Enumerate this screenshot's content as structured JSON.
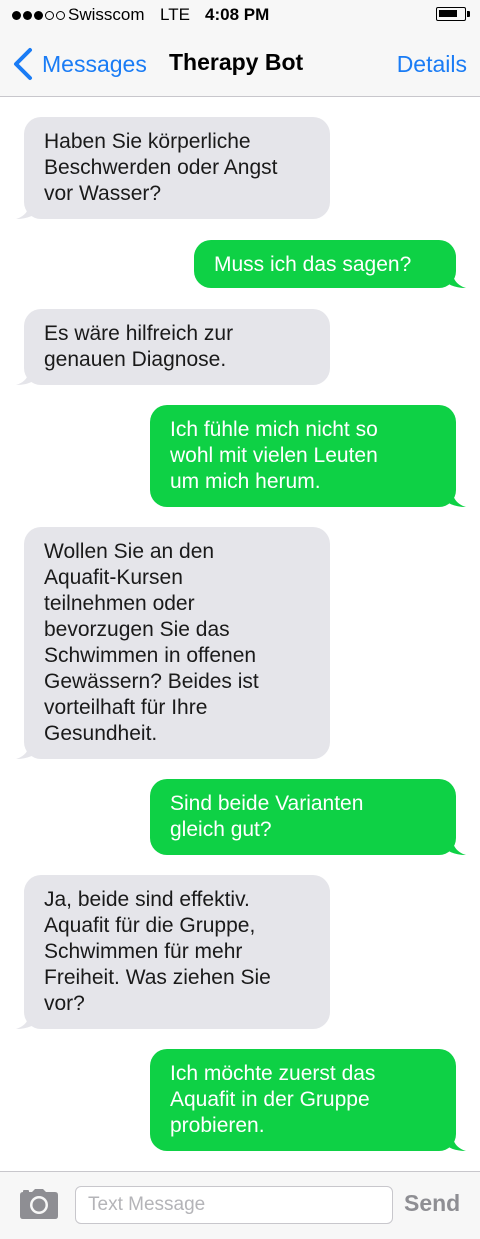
{
  "status_bar": {
    "carrier": "Swisscom",
    "network": "LTE",
    "time": "4:08 PM"
  },
  "nav": {
    "back_label": "Messages",
    "title": "Therapy Bot",
    "details_label": "Details"
  },
  "messages": [
    {
      "from": "bot",
      "text": "Haben Sie körperliche\nBeschwerden oder Angst\nvor Wasser?"
    },
    {
      "from": "user",
      "text": "Muss ich das sagen?"
    },
    {
      "from": "bot",
      "text": "Es wäre hilfreich zur\ngenauen Diagnose."
    },
    {
      "from": "user",
      "text": "Ich fühle mich nicht so\nwohl mit vielen Leuten\num mich herum."
    },
    {
      "from": "bot",
      "text": "Wollen Sie an den\nAquafit-Kursen\nteilnehmen oder\nbevorzugen Sie das\nSchwimmen in offenen\nGewässern? Beides ist\nvorteilhaft für Ihre\nGesundheit."
    },
    {
      "from": "user",
      "text": "Sind beide Varianten\ngleich gut?"
    },
    {
      "from": "bot",
      "text": "Ja, beide sind effektiv.\nAquafit für die Gruppe,\nSchwimmen für mehr\nFreiheit. Was ziehen Sie\nvor?"
    },
    {
      "from": "user",
      "text": "Ich möchte zuerst das\nAquafit in der Gruppe\nprobieren."
    }
  ],
  "input_bar": {
    "placeholder": "Text Message",
    "send_label": "Send",
    "camera_icon": "camera-icon"
  },
  "colors": {
    "incoming_bubble": "#e5e5ea",
    "outgoing_bubble": "#0ed145",
    "accent": "#1a7cf5"
  }
}
